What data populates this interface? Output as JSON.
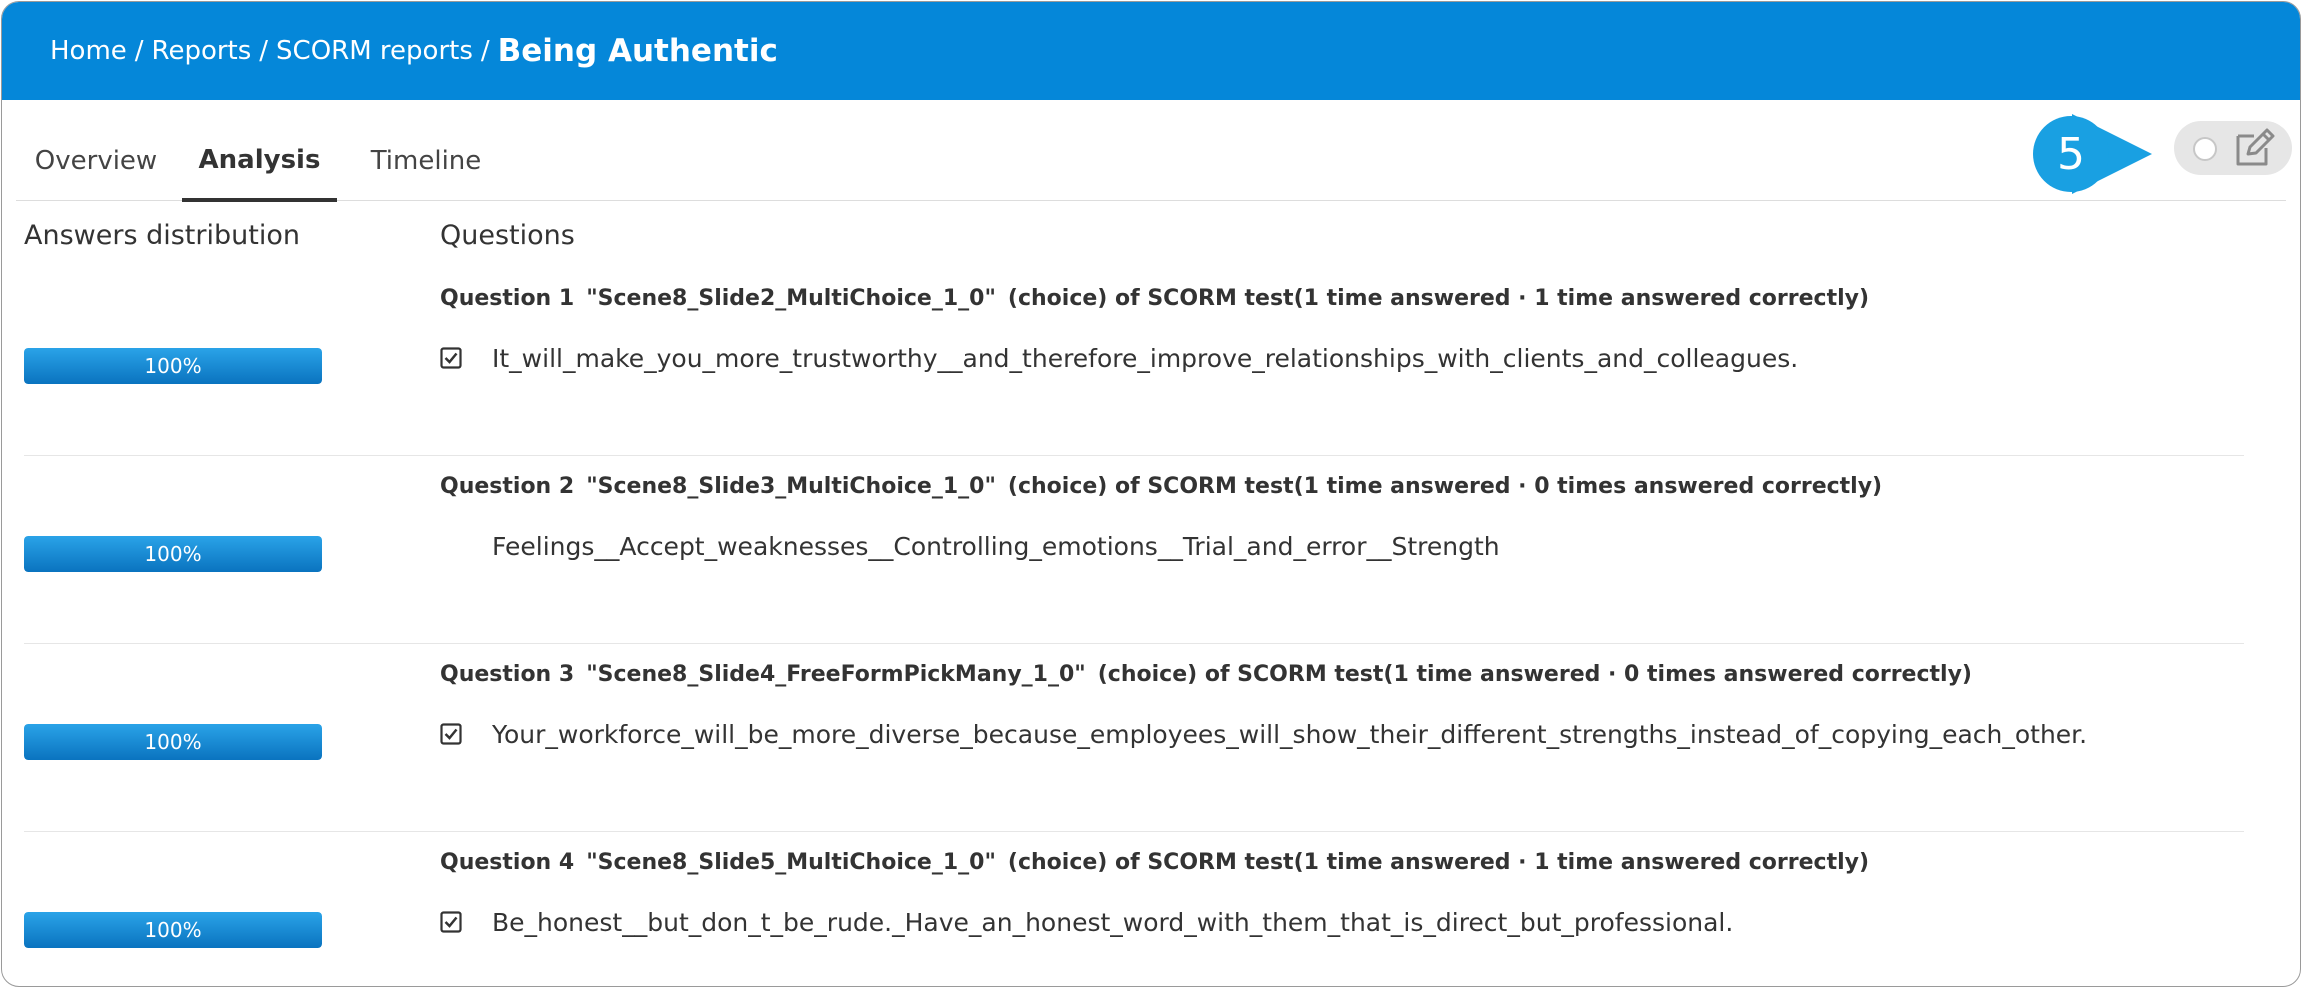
{
  "breadcrumb": {
    "items": [
      "Home",
      "Reports",
      "SCORM reports"
    ],
    "separator": "/",
    "current": "Being Authentic"
  },
  "tabs": [
    {
      "label": "Overview",
      "active": false
    },
    {
      "label": "Analysis",
      "active": true
    },
    {
      "label": "Timeline",
      "active": false
    }
  ],
  "callout": {
    "number": "5"
  },
  "toggle": {
    "state": "off",
    "icon": "edit-icon"
  },
  "columns": {
    "distribution_title": "Answers distribution",
    "questions_title": "Questions"
  },
  "questions": [
    {
      "label": "Question 1",
      "name": "\"Scene8_Slide2_MultiChoice_1_0\"",
      "stats": "(choice) of SCORM test(1 time answered · 1 time answered correctly)",
      "answer": "It_will_make_you_more_trustworthy__and_therefore_improve_relationships_with_clients_and_colleagues.",
      "checked": true,
      "distribution_pct": 100,
      "distribution_label": "100%"
    },
    {
      "label": "Question 2",
      "name": "\"Scene8_Slide3_MultiChoice_1_0\"",
      "stats": "(choice) of SCORM test(1 time answered · 0 times answered correctly)",
      "answer": "Feelings__Accept_weaknesses__Controlling_emotions__Trial_and_error__Strength",
      "checked": false,
      "distribution_pct": 100,
      "distribution_label": "100%"
    },
    {
      "label": "Question 3",
      "name": "\"Scene8_Slide4_FreeFormPickMany_1_0\"",
      "stats": "(choice) of SCORM test(1 time answered · 0 times answered correctly)",
      "answer": "Your_workforce_will_be_more_diverse_because_employees_will_show_their_different_strengths_instead_of_copying_each_other.",
      "checked": true,
      "distribution_pct": 100,
      "distribution_label": "100%"
    },
    {
      "label": "Question 4",
      "name": "\"Scene8_Slide5_MultiChoice_1_0\"",
      "stats": "(choice) of SCORM test(1 time answered · 1 time answered correctly)",
      "answer": "Be_honest__but_don_t_be_rude._Have_an_honest_word_with_them_that_is_direct_but_professional.",
      "checked": true,
      "distribution_pct": 100,
      "distribution_label": "100%"
    }
  ],
  "colors": {
    "header_bg": "#0587d9",
    "callout_bg": "#19a0e2",
    "bar_fill": "#0a73bf"
  }
}
